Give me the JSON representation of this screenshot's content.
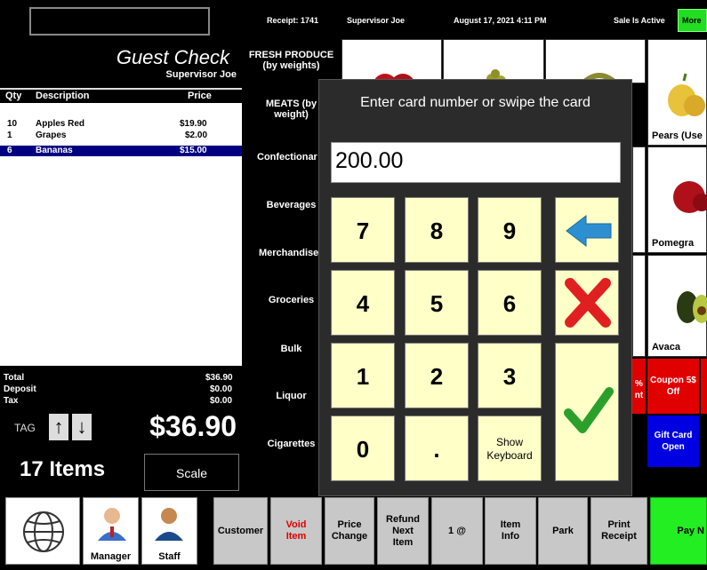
{
  "topbar": {
    "receipt": "Receipt: 1741",
    "user": "Supervisor Joe",
    "datetime": "August 17, 2021  4:11 PM",
    "sale_status": "Sale Is Active",
    "more_label": "More"
  },
  "guest_check": {
    "title": "Guest Check",
    "subtitle": "Supervisor Joe",
    "headers": {
      "qty": "Qty",
      "description": "Description",
      "price": "Price"
    },
    "rows": [
      {
        "qty": "10",
        "description": "Apples Red",
        "price": "$19.90"
      },
      {
        "qty": "1",
        "description": "Grapes",
        "price": "$2.00"
      },
      {
        "qty": "6",
        "description": "Bananas",
        "price": "$15.00"
      }
    ],
    "totals": {
      "total_label": "Total",
      "total": "$36.90",
      "deposit_label": "Deposit",
      "deposit": "$0.00",
      "tax_label": "Tax",
      "tax": "$0.00"
    },
    "tag_label": "TAG",
    "grand_total": "$36.90",
    "items_count": "17 Items",
    "scale_label": "Scale"
  },
  "categories": [
    "FRESH PRODUCE (by weights)",
    "MEATS  (by weight)",
    "Confectionar",
    "Beverages",
    "Merchandise",
    "Groceries",
    "Bulk",
    "Liquor",
    "Cigarettes"
  ],
  "products": {
    "pears": "Pears (Use",
    "pomegranate": "Pomegra",
    "avocado": "Avaca",
    "coupon": "Coupon 5$ Off",
    "gift_card": "Gift Card Open",
    "partial_red": "% nt"
  },
  "dialog": {
    "title": "Enter card number or swipe the card",
    "value": "200.00",
    "keys": [
      "7",
      "8",
      "9",
      "4",
      "5",
      "6",
      "1",
      "2",
      "3",
      "0",
      "."
    ],
    "show_keyboard": "Show Keyboard"
  },
  "bottom": {
    "manager": "Manager",
    "staff": "Staff",
    "customer": "Customer",
    "void_item": "Void Item",
    "price_change": "Price Change",
    "refund_next": "Refund Next Item",
    "one_at": "1 @",
    "item_info": "Item Info",
    "park": "Park",
    "print_receipt": "Print Receipt",
    "pay": "Pay N"
  },
  "colors": {
    "accent_green": "#22dd22",
    "selected_row": "#000080",
    "keypad": "#ffffc8",
    "coupon_red": "#e00000",
    "gift_blue": "#0000e0",
    "void_text": "#e00000"
  }
}
